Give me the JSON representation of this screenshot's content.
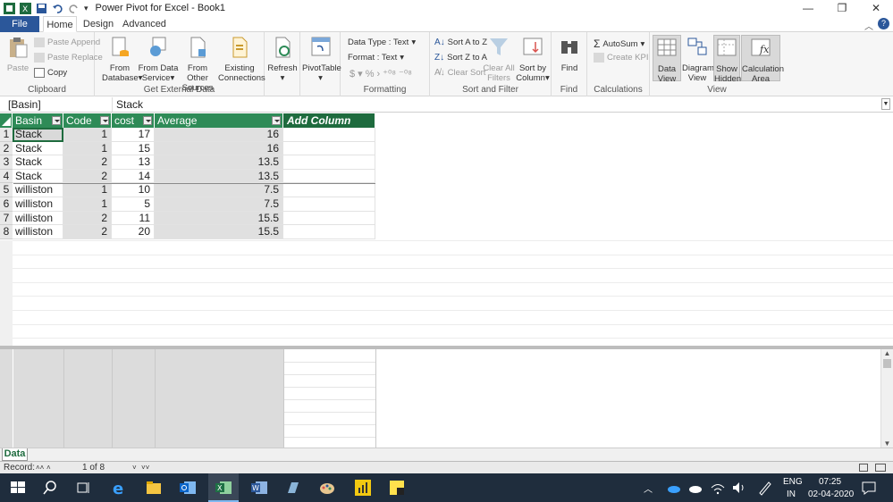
{
  "window": {
    "title": "Power Pivot for Excel - Book1"
  },
  "tabs": [
    "File",
    "Home",
    "Design",
    "Advanced"
  ],
  "ribbon": {
    "paste": "Paste",
    "paste_append": "Paste Append",
    "paste_replace": "Paste Replace",
    "copy": "Copy",
    "clipboard": "Clipboard",
    "from_database": [
      "From",
      "Database"
    ],
    "from_data_service": [
      "From Data",
      "Service"
    ],
    "from_other_sources": [
      "From Other",
      "Sources"
    ],
    "existing_connections": [
      "Existing",
      "Connections"
    ],
    "get_external_data": "Get External Data",
    "refresh": "Refresh",
    "pivottable": "PivotTable",
    "data_type": "Data Type : Text",
    "format": "Format : Text",
    "formatting": "Formatting",
    "sort_az": "Sort A to Z",
    "sort_za": "Sort Z to A",
    "clear_sort": "Clear Sort",
    "clear_all_filters": [
      "Clear All",
      "Filters"
    ],
    "sort_by_column": [
      "Sort by",
      "Column"
    ],
    "sort_and_filter": "Sort and Filter",
    "find": "Find",
    "find_group": "Find",
    "autosum": "AutoSum",
    "create_kpi": "Create KPI",
    "calculations": "Calculations",
    "data_view": [
      "Data",
      "View"
    ],
    "diagram_view": [
      "Diagram",
      "View"
    ],
    "show_hidden": [
      "Show",
      "Hidden"
    ],
    "calculation_area": [
      "Calculation",
      "Area"
    ],
    "view_group": "View"
  },
  "formula": {
    "name": "[Basin]",
    "value": "Stack"
  },
  "table": {
    "headers": [
      "Basin",
      "Code",
      "cost",
      "Average",
      "Add Column"
    ],
    "rows": [
      [
        "1",
        "Stack",
        "1",
        "17",
        "16"
      ],
      [
        "2",
        "Stack",
        "1",
        "15",
        "16"
      ],
      [
        "3",
        "Stack",
        "2",
        "13",
        "13.5"
      ],
      [
        "4",
        "Stack",
        "2",
        "14",
        "13.5"
      ],
      [
        "5",
        "williston",
        "1",
        "10",
        "7.5"
      ],
      [
        "6",
        "williston",
        "1",
        "5",
        "7.5"
      ],
      [
        "7",
        "williston",
        "2",
        "11",
        "15.5"
      ],
      [
        "8",
        "williston",
        "2",
        "20",
        "15.5"
      ]
    ]
  },
  "sheet_tab": "Data",
  "status": {
    "record": "Record:",
    "position": "1 of 8"
  },
  "taskbar": {
    "lang1": "ENG",
    "lang2": "IN",
    "time": "07:25",
    "date": "02-04-2020"
  },
  "colors": {
    "accent": "#2b579a",
    "header": "#2e8b57",
    "taskbar": "#1f2d3d"
  }
}
